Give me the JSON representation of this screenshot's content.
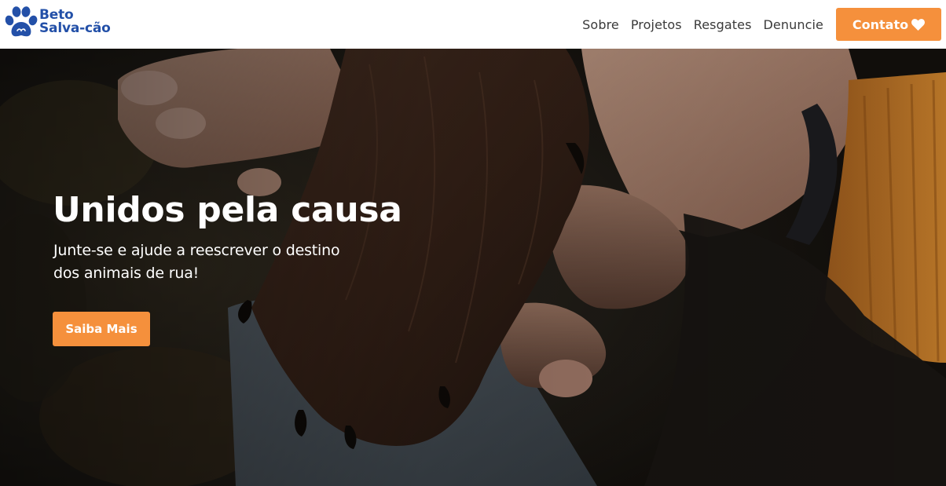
{
  "brand": {
    "line1": "Beto",
    "line2": "Salva-cão",
    "icon": "paw-icon",
    "color": "#2350a8"
  },
  "nav": {
    "items": [
      {
        "label": "Sobre"
      },
      {
        "label": "Projetos"
      },
      {
        "label": "Resgates"
      },
      {
        "label": "Denuncie"
      }
    ],
    "contact_label": "Contato",
    "contact_icon": "heart-icon",
    "accent": "#f5903c"
  },
  "hero": {
    "title": "Unidos pela causa",
    "subtitle": "Junte-se e ajude a reescrever o destino dos animais de rua!",
    "cta_label": "Saiba Mais",
    "image": "dog-paw-in-human-hand-photo"
  }
}
